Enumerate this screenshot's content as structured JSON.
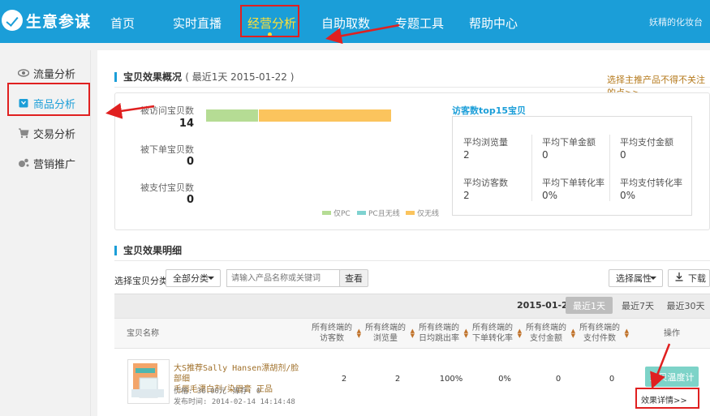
{
  "header": {
    "logo_text": "生意参谋",
    "nav": [
      {
        "label": "首页"
      },
      {
        "label": "实时直播"
      },
      {
        "label": "经营分析"
      },
      {
        "label": "自助取数"
      },
      {
        "label": "专题工具"
      },
      {
        "label": "帮助中心"
      }
    ],
    "active_nav": "经营分析",
    "user": "妖精的化妆台"
  },
  "sidebar": {
    "items": [
      {
        "label": "流量分析",
        "icon": "eye-icon"
      },
      {
        "label": "商品分析",
        "icon": "product-icon"
      },
      {
        "label": "交易分析",
        "icon": "cart-icon"
      },
      {
        "label": "营销推广",
        "icon": "megaphone-icon"
      }
    ],
    "active": "商品分析"
  },
  "overview": {
    "title": "宝贝效果概况",
    "subtitle": "( 最近1天 2015-01-22 )",
    "top_link": "选择主推产品不得不关注的点>>",
    "stats": [
      {
        "label": "被访问宝贝数",
        "value": "14"
      },
      {
        "label": "被下单宝贝数",
        "value": "0"
      },
      {
        "label": "被支付宝贝数",
        "value": "0"
      }
    ],
    "bar": {
      "segments": [
        {
          "name": "仅PC",
          "fraction": 0.28,
          "color": "#b5dc94"
        },
        {
          "name": "PC且无线",
          "fraction": 0.0,
          "color": "#7fd2d0"
        },
        {
          "name": "仅无线",
          "fraction": 0.72,
          "color": "#fbc45d"
        }
      ]
    },
    "legend": [
      "仅PC",
      "PC且无线",
      "仅无线"
    ],
    "top15": {
      "title": "访客数top15宝贝",
      "cells": [
        {
          "label": "平均浏览量",
          "value": "2"
        },
        {
          "label": "平均下单金额",
          "value": "0"
        },
        {
          "label": "平均支付金额",
          "value": "0"
        },
        {
          "label": "平均访客数",
          "value": "2"
        },
        {
          "label": "平均下单转化率",
          "value": "0%"
        },
        {
          "label": "平均支付转化率",
          "value": "0%"
        }
      ]
    }
  },
  "detail": {
    "title": "宝贝效果明细",
    "filter_label": "选择宝贝分类",
    "category_select": "全部分类",
    "search_placeholder": "请输入产品名称或关键词",
    "search_button": "查看",
    "attr_select": "选择属性",
    "download_button": "下载",
    "date": "2015-01-22",
    "ranges": [
      "最近1天",
      "最近7天",
      "最近30天"
    ],
    "active_range": "最近1天",
    "columns": {
      "name": "宝贝名称",
      "metrics": [
        [
          "所有终端的",
          "访客数"
        ],
        [
          "所有终端的",
          "浏览量"
        ],
        [
          "所有终端的",
          "日均跳出率"
        ],
        [
          "所有终端的",
          "下单转化率"
        ],
        [
          "所有终端的",
          "支付金额"
        ],
        [
          "所有终端的",
          "支付件数"
        ]
      ],
      "op": "操作"
    },
    "rows": [
      {
        "title_line1": "大S推荐Sally Hansen漂胡剂/脸部细",
        "title_line2": "毛唇毛漂白剂/染眉膏 正品",
        "price": "价格: 36.00元",
        "stock": "库存: 0",
        "published": "发布时间: 2014-02-14 14:14:48",
        "values": [
          "2",
          "2",
          "100%",
          "0%",
          "0",
          "0"
        ],
        "op_button": "宝贝温度计",
        "op_link": "效果详情>>"
      }
    ]
  }
}
